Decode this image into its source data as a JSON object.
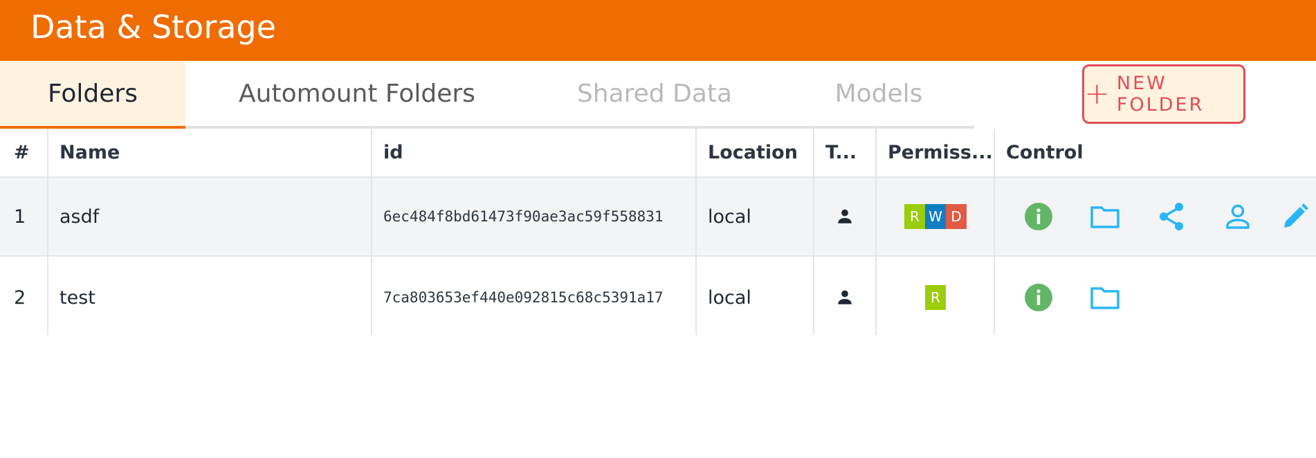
{
  "header": {
    "title": "Data & Storage"
  },
  "tabs": [
    {
      "label": "Folders",
      "state": "active"
    },
    {
      "label": "Automount Folders",
      "state": "normal"
    },
    {
      "label": "Shared Data",
      "state": "disabled"
    },
    {
      "label": "Models",
      "state": "disabled"
    }
  ],
  "new_folder_button": {
    "plus": "+",
    "label": "NEW FOLDER"
  },
  "table": {
    "columns": [
      "#",
      "Name",
      "id",
      "Location",
      "T...",
      "Permiss...",
      "Control"
    ],
    "rows": [
      {
        "index": "1",
        "name": "asdf",
        "id": "6ec484f8bd61473f90ae3ac59f558831",
        "location": "local",
        "type_icon": "user-icon",
        "permissions": [
          "R",
          "W",
          "D"
        ],
        "controls": [
          "info-icon",
          "folder-icon",
          "share-icon",
          "user-outline-icon",
          "pencil-icon"
        ]
      },
      {
        "index": "2",
        "name": "test",
        "id": "7ca803653ef440e092815c68c5391a17",
        "location": "local",
        "type_icon": "user-icon",
        "permissions": [
          "R"
        ],
        "controls": [
          "info-icon",
          "folder-icon"
        ]
      }
    ]
  },
  "colors": {
    "accent": "#ef6c00",
    "perm_r": "#9acd0c",
    "perm_w": "#0f7ec3",
    "perm_d": "#e05a44",
    "info_green": "#62b666",
    "icon_blue": "#29b6f6",
    "danger_red": "#e34b56"
  }
}
